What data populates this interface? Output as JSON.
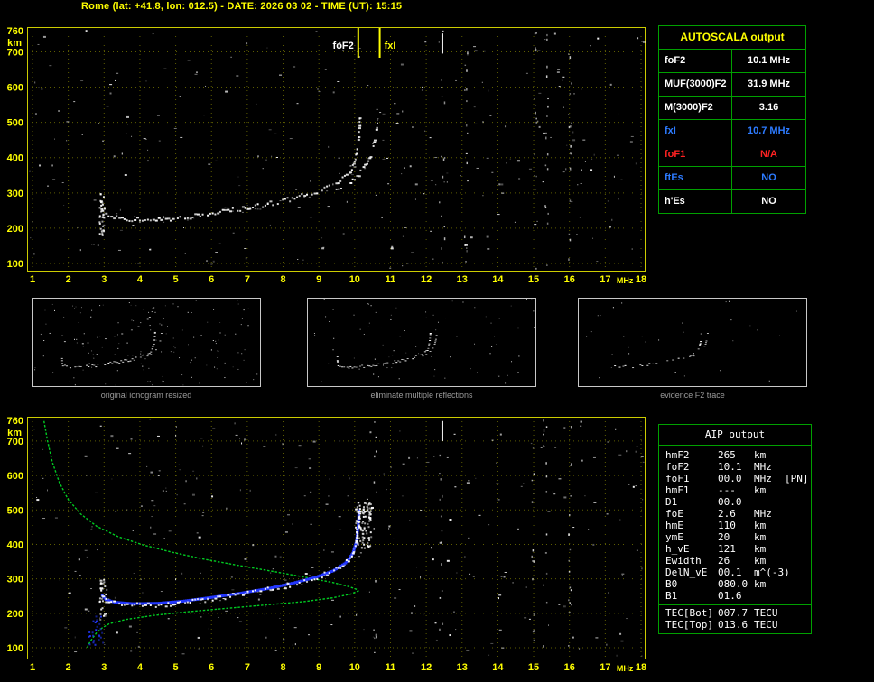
{
  "header": {
    "title": "Rome (lat: +41.8, lon: 012.5) - DATE: 2026 03 02 - TIME (UT): 15:15"
  },
  "colors": {
    "accent_yellow": "#ffff00",
    "border_yellow": "#cccc00",
    "grid": "#5e5e00",
    "table_green": "#00a000",
    "value_blue": "#2d7bff",
    "value_red": "#ff2222",
    "trace_white": "#ffffff",
    "fit_blue": "#2337ff",
    "profile_green": "#00cc22",
    "caption_gray": "#9a9a9a",
    "thumb_border": "#c8c8c8"
  },
  "autoscala_table": {
    "title": "AUTOSCALA output",
    "rows": [
      {
        "label": "foF2",
        "value": "10.1 MHz",
        "color": "#ffffff"
      },
      {
        "label": "MUF(3000)F2",
        "value": "31.9 MHz",
        "color": "#ffffff"
      },
      {
        "label": "M(3000)F2",
        "value": "3.16",
        "color": "#ffffff"
      },
      {
        "label": "fxI",
        "value": "10.7 MHz",
        "color": "#2d7bff"
      },
      {
        "label": "foF1",
        "value": "N/A",
        "color": "#ff2222"
      },
      {
        "label": "ftEs",
        "value": "NO",
        "color": "#2d7bff"
      },
      {
        "label": "h'Es",
        "value": "NO",
        "color": "#ffffff"
      }
    ]
  },
  "thumbnails": [
    {
      "caption": "original ionogram resized",
      "noise": 150,
      "density": 0.75,
      "multiples": true,
      "from_mhz": 0
    },
    {
      "caption": "eliminate multiple reflections",
      "noise": 80,
      "density": 0.75,
      "multiples": false,
      "from_mhz": 0
    },
    {
      "caption": "evidence F2 trace",
      "noise": 30,
      "density": 0.45,
      "multiples": false,
      "from_mhz": 3.2
    }
  ],
  "aip_table": {
    "title": "AIP output",
    "rows": [
      {
        "param": "hmF2",
        "value": "265",
        "unit": "km",
        "extra": ""
      },
      {
        "param": "foF2",
        "value": "10.1",
        "unit": "MHz",
        "extra": ""
      },
      {
        "param": "foF1",
        "value": "00.0",
        "unit": "MHz",
        "extra": "[PN]"
      },
      {
        "param": "hmF1",
        "value": "---",
        "unit": "km",
        "extra": ""
      },
      {
        "param": "D1",
        "value": "00.0",
        "unit": "",
        "extra": ""
      },
      {
        "param": "foE",
        "value": "2.6",
        "unit": "MHz",
        "extra": ""
      },
      {
        "param": "hmE",
        "value": "110",
        "unit": "km",
        "extra": ""
      },
      {
        "param": "ymE",
        "value": "20",
        "unit": "km",
        "extra": ""
      },
      {
        "param": "h_vE",
        "value": "121",
        "unit": "km",
        "extra": ""
      },
      {
        "param": "Ewidth",
        "value": "26",
        "unit": "km",
        "extra": ""
      },
      {
        "param": "DelN_vE",
        "value": "00.1",
        "unit": "m^(-3)",
        "extra": ""
      },
      {
        "param": "B0",
        "value": "080.0",
        "unit": "km",
        "extra": ""
      },
      {
        "param": "B1",
        "value": "01.6",
        "unit": "",
        "extra": ""
      }
    ],
    "tec_rows": [
      {
        "param": "TEC[Bot]",
        "value": "007.7",
        "unit": "TECU",
        "extra": ""
      },
      {
        "param": "TEC[Top]",
        "value": "013.6",
        "unit": "TECU",
        "extra": ""
      }
    ]
  },
  "chart_data": [
    {
      "type": "scatter",
      "name": "scaled ionogram with autoscala markers",
      "xlabel": "MHz",
      "ylabel": "km",
      "xlim": [
        1,
        18
      ],
      "ylim": [
        100,
        760
      ],
      "x_ticks": [
        1,
        2,
        3,
        4,
        5,
        6,
        7,
        8,
        9,
        10,
        11,
        12,
        13,
        14,
        15,
        16,
        17,
        18
      ],
      "y_ticks": [
        100,
        200,
        300,
        400,
        500,
        600,
        700,
        760
      ],
      "annotations": [
        {
          "label": "foF2",
          "x_mhz": 10.1,
          "side": "left",
          "color": "#ffffff"
        },
        {
          "label": "fxI",
          "x_mhz": 10.7,
          "side": "right",
          "color": "#ffff00"
        }
      ],
      "series": [
        {
          "name": "O-mode F2 trace",
          "style": "trace",
          "color": "#ffffff",
          "density": 0.85,
          "points": [
            [
              2.88,
              300
            ],
            [
              2.9,
              262
            ],
            [
              2.95,
              245
            ],
            [
              3.1,
              236
            ],
            [
              3.4,
              229
            ],
            [
              3.9,
              226
            ],
            [
              4.5,
              227
            ],
            [
              5.1,
              232
            ],
            [
              5.8,
              241
            ],
            [
              6.5,
              252
            ],
            [
              7.2,
              264
            ],
            [
              7.9,
              278
            ],
            [
              8.5,
              293
            ],
            [
              9.0,
              309
            ],
            [
              9.4,
              326
            ],
            [
              9.7,
              346
            ],
            [
              9.9,
              370
            ],
            [
              10.0,
              398
            ],
            [
              10.07,
              440
            ],
            [
              10.11,
              492
            ],
            [
              10.12,
              515
            ]
          ]
        },
        {
          "name": "X-mode F2 trace",
          "style": "trace",
          "color": "#ffffff",
          "density": 0.6,
          "points": [
            [
              9.4,
              310
            ],
            [
              9.8,
              330
            ],
            [
              10.1,
              355
            ],
            [
              10.3,
              382
            ],
            [
              10.45,
              415
            ],
            [
              10.55,
              455
            ],
            [
              10.62,
              505
            ]
          ]
        },
        {
          "name": "leading-edge spread",
          "style": "smear",
          "x": [
            2.85,
            3.0
          ],
          "y": [
            180,
            300
          ],
          "count": 30
        }
      ],
      "noise": {
        "seed": 20260302,
        "speckles": 270,
        "streak_mhz": [
          12.45,
          13.1,
          15.05,
          15.35,
          16.0
        ],
        "streak_density": 16,
        "bars": [
          {
            "x_mhz": 12.45,
            "km": [
              695,
              752
            ]
          }
        ]
      }
    },
    {
      "type": "scatter",
      "name": "ionogram with fitted trace and electron density profile",
      "xlabel": "MHz",
      "ylabel": "km",
      "xlim": [
        1,
        18
      ],
      "ylim": [
        100,
        760
      ],
      "x_ticks": [
        1,
        2,
        3,
        4,
        5,
        6,
        7,
        8,
        9,
        10,
        11,
        12,
        13,
        14,
        15,
        16,
        17,
        18
      ],
      "y_ticks": [
        100,
        200,
        300,
        400,
        500,
        600,
        700,
        760
      ],
      "annotations": [],
      "series": [
        {
          "name": "plasma frequency profile",
          "style": "line",
          "color": "#00cc22",
          "points": [
            [
              1.32,
              758
            ],
            [
              1.42,
              700
            ],
            [
              1.55,
              640
            ],
            [
              1.75,
              580
            ],
            [
              2.0,
              530
            ],
            [
              2.35,
              488
            ],
            [
              2.8,
              452
            ],
            [
              3.4,
              422
            ],
            [
              4.1,
              398
            ],
            [
              4.9,
              377
            ],
            [
              5.8,
              357
            ],
            [
              6.8,
              338
            ],
            [
              7.8,
              320
            ],
            [
              8.7,
              303
            ],
            [
              9.4,
              289
            ],
            [
              9.85,
              277
            ],
            [
              10.07,
              269
            ],
            [
              10.1,
              265
            ],
            [
              9.9,
              256
            ],
            [
              9.4,
              245
            ],
            [
              8.6,
              234
            ],
            [
              7.6,
              225
            ],
            [
              6.5,
              215
            ],
            [
              5.4,
              205
            ],
            [
              4.4,
              194
            ],
            [
              3.6,
              182
            ],
            [
              3.15,
              170
            ],
            [
              2.95,
              158
            ],
            [
              2.8,
              145
            ],
            [
              2.7,
              131
            ],
            [
              2.62,
              119
            ],
            [
              2.56,
              108
            ],
            [
              2.53,
              100
            ]
          ]
        },
        {
          "name": "fitted F2 trace",
          "style": "fit",
          "color": "#2337ff",
          "points": [
            [
              2.95,
              252
            ],
            [
              3.05,
              240
            ],
            [
              3.3,
              232
            ],
            [
              3.8,
              228
            ],
            [
              4.5,
              229
            ],
            [
              5.2,
              235
            ],
            [
              6.0,
              246
            ],
            [
              6.8,
              258
            ],
            [
              7.6,
              272
            ],
            [
              8.3,
              288
            ],
            [
              8.9,
              304
            ],
            [
              9.4,
              323
            ],
            [
              9.75,
              346
            ],
            [
              9.95,
              374
            ],
            [
              10.05,
              408
            ],
            [
              10.1,
              455
            ],
            [
              10.12,
              498
            ]
          ]
        },
        {
          "name": "O-mode F2 trace",
          "style": "trace",
          "color": "#ffffff",
          "density": 0.8,
          "points": [
            [
              2.88,
              300
            ],
            [
              2.9,
              262
            ],
            [
              2.95,
              245
            ],
            [
              3.1,
              236
            ],
            [
              3.4,
              229
            ],
            [
              3.9,
              226
            ],
            [
              4.5,
              227
            ],
            [
              5.1,
              232
            ],
            [
              5.8,
              241
            ],
            [
              6.5,
              252
            ],
            [
              7.2,
              264
            ],
            [
              7.9,
              278
            ],
            [
              8.5,
              293
            ],
            [
              9.0,
              309
            ],
            [
              9.4,
              326
            ],
            [
              9.7,
              346
            ],
            [
              9.9,
              370
            ],
            [
              10.0,
              398
            ],
            [
              10.07,
              440
            ],
            [
              10.11,
              492
            ],
            [
              10.12,
              515
            ]
          ]
        },
        {
          "name": "cusp spread",
          "style": "smear",
          "x": [
            10.0,
            10.45
          ],
          "y": [
            390,
            525
          ],
          "count": 100
        },
        {
          "name": "E-region echoes",
          "style": "smear",
          "x": [
            2.55,
            2.95
          ],
          "y": [
            110,
            200
          ],
          "count": 26,
          "color": "#2337ff"
        },
        {
          "name": "leading-edge spread",
          "style": "smear",
          "x": [
            2.85,
            3.05
          ],
          "y": [
            180,
            300
          ],
          "count": 24
        }
      ],
      "noise": {
        "seed": 151515,
        "speckles": 300,
        "streak_mhz": [
          12.4,
          14.95,
          15.3,
          16.0,
          10.55
        ],
        "streak_density": 14,
        "bars": [
          {
            "x_mhz": 12.45,
            "km": [
              700,
              758
            ]
          }
        ]
      }
    }
  ]
}
